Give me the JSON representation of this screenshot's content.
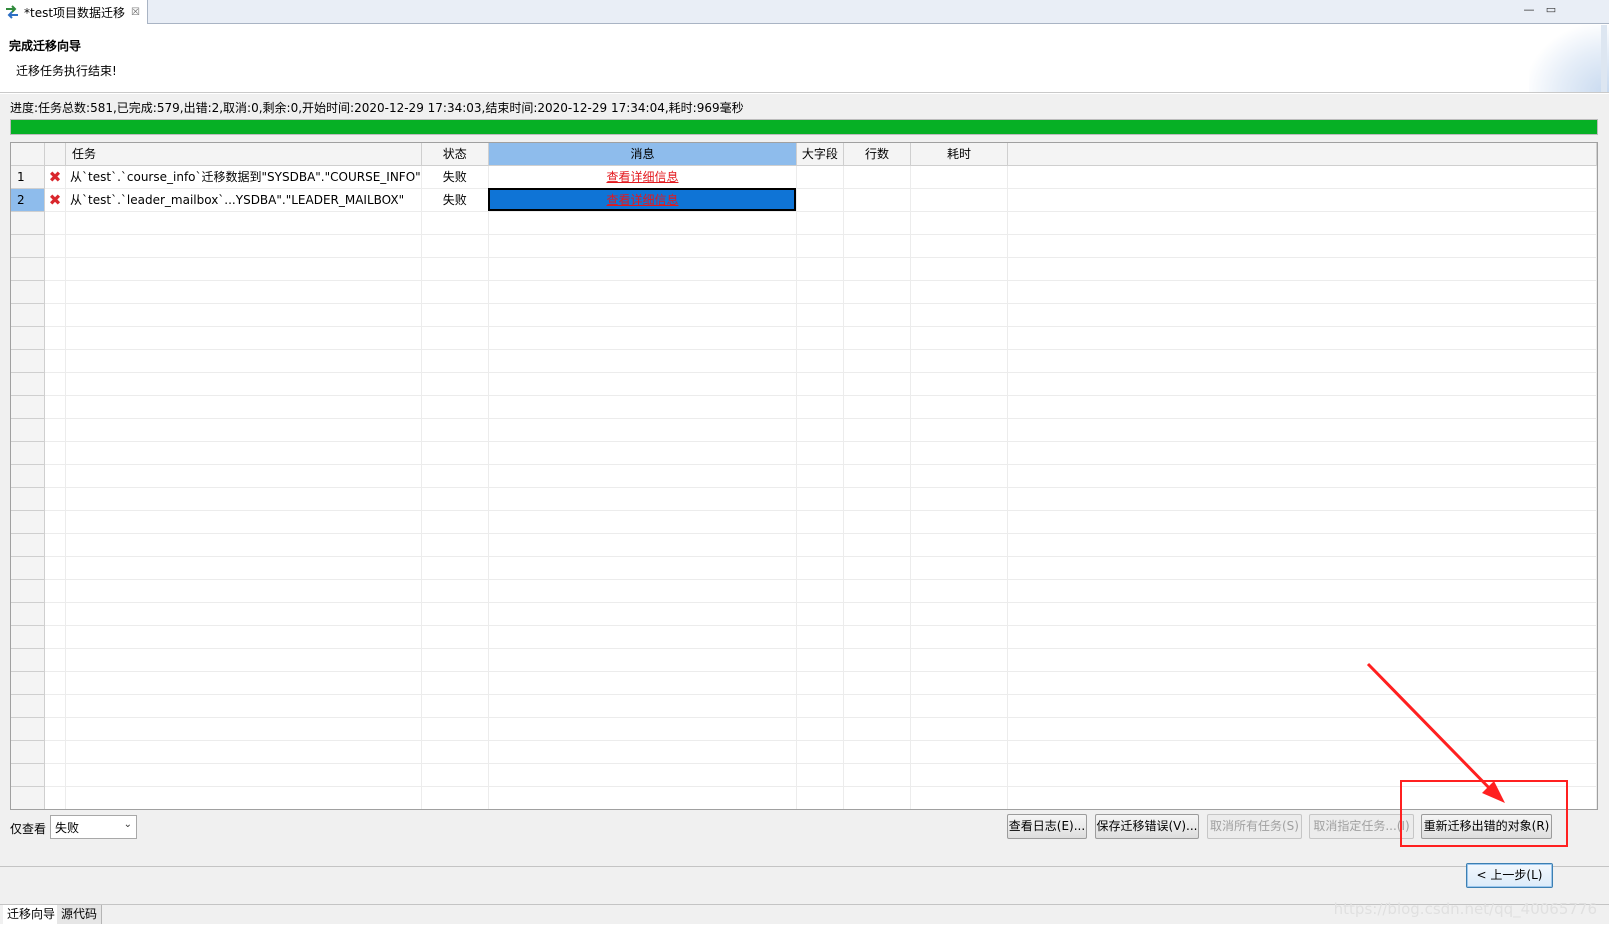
{
  "editor_tab": {
    "title": "*test项目数据迁移",
    "icon": "migration-arrows-icon"
  },
  "header": {
    "title": "完成迁移向导",
    "description": "迁移任务执行结束!"
  },
  "progress": {
    "text": "进度:任务总数:581,已完成:579,出错:2,取消:0,剩余:0,开始时间:2020-12-29 17:34:03,结束时间:2020-12-29 17:34:04,耗时:969毫秒",
    "fill_fraction": 1.0,
    "color": "#06b025"
  },
  "table": {
    "columns": [
      "任务",
      "状态",
      "消息",
      "大字段",
      "行数",
      "耗时"
    ],
    "rows": [
      {
        "num": "1",
        "icon": "error-x-icon",
        "task": "从`test`.`course_info`迁移数据到\"SYSDBA\".\"COURSE_INFO\"",
        "status": "失败",
        "message": "查看详细信息",
        "lob": "",
        "rows": "",
        "time": ""
      },
      {
        "num": "2",
        "icon": "error-x-icon",
        "task": "从`test`.`leader_mailbox`...YSDBA\".\"LEADER_MAILBOX\"",
        "status": "失败",
        "message": "查看详细信息",
        "lob": "",
        "rows": "",
        "time": ""
      }
    ],
    "selected_row": 2
  },
  "filter": {
    "label": "仅查看",
    "value": "失败"
  },
  "buttons": {
    "view_log": "查看日志(E)...",
    "save_errors": "保存迁移错误(V)...",
    "cancel_all": "取消所有任务(S)",
    "cancel_selected": "取消指定任务...(I)",
    "remigrate_failed": "重新迁移出错的对象(R)",
    "back": "< 上一步(L)"
  },
  "bottom_tabs": [
    "迁移向导",
    "源代码"
  ],
  "watermark": "https://blog.csdn.net/qq_40065776",
  "colors": {
    "accent": "#8ebcec",
    "error": "#e3191e",
    "annotation": "#ff2020"
  }
}
